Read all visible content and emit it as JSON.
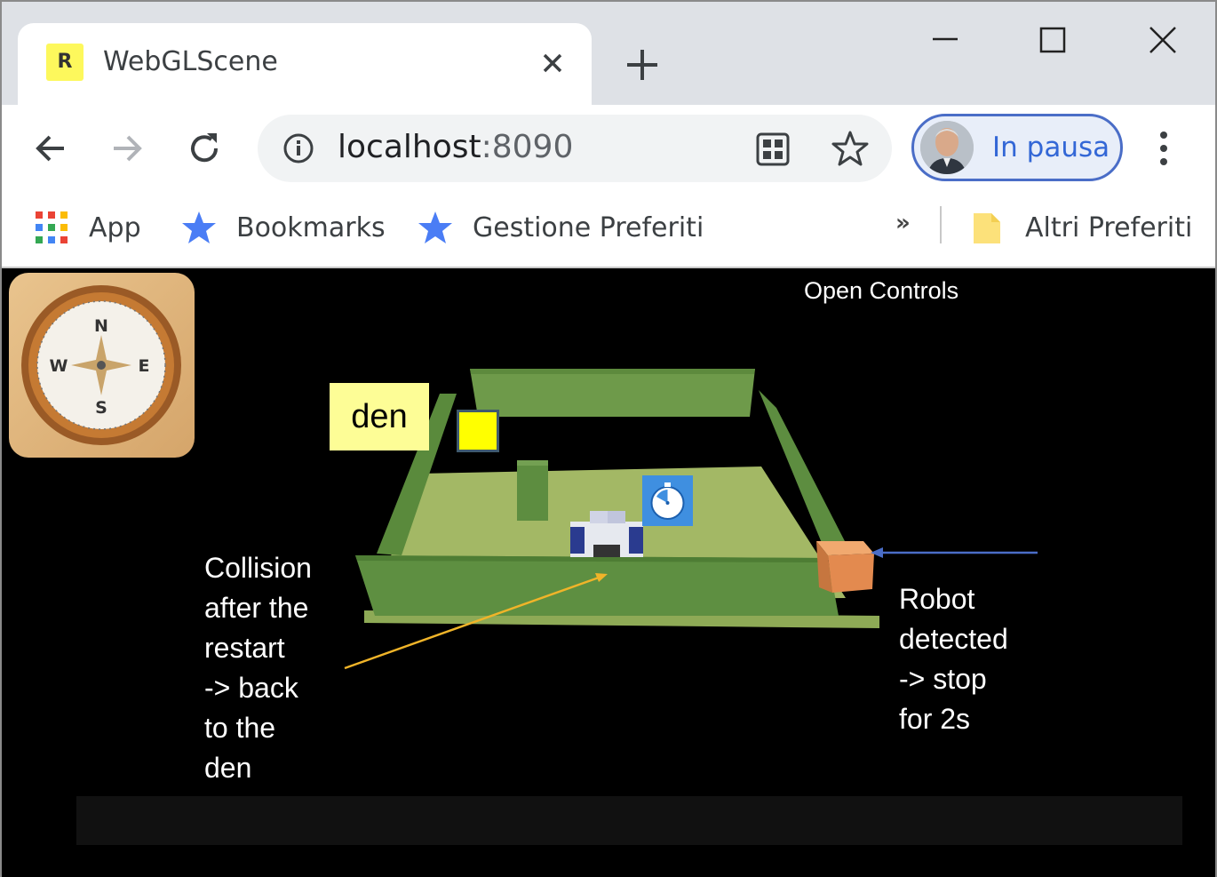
{
  "browser": {
    "tab_title": "WebGLScene",
    "tab_favicon_letter": "R",
    "url_host": "localhost",
    "url_port": ":8090",
    "profile_label": "In pausa"
  },
  "bookmarks": {
    "apps": "App",
    "items": [
      "Bookmarks",
      "Gestione Preferiti"
    ],
    "more": "»",
    "other": "Altri Preferiti"
  },
  "page": {
    "open_controls": "Open Controls",
    "den_label": "den",
    "compass_letters": {
      "n": "N",
      "s": "S",
      "e": "E",
      "w": "W"
    }
  },
  "annotations": {
    "left": [
      "Collision",
      "after the",
      "restart",
      "-> back",
      "to the",
      "den"
    ],
    "right": [
      "Robot",
      "detected",
      "-> stop",
      "for 2s"
    ]
  },
  "colors": {
    "arrow_left": "#f0b429",
    "arrow_right": "#4a6dc7",
    "den_label_bg": "#fdfd96",
    "den_marker": "#ffff00",
    "floor": "#a3b865",
    "wall": "#6a9a4c",
    "sonar_box": "#e38a4f"
  },
  "icons": [
    "reload-icon",
    "back-icon",
    "forward-icon",
    "info-icon",
    "qr-icon",
    "star-icon",
    "menu-icon",
    "timer-icon",
    "compass-icon"
  ]
}
